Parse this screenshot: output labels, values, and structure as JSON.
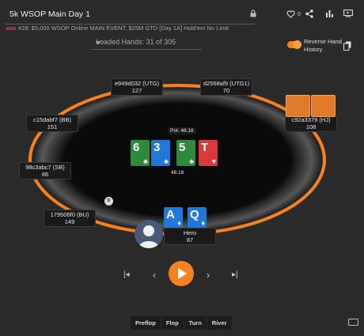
{
  "header": {
    "title": "5k WSOP Main Day 1",
    "hand_history": "#28: $5,000 WSOP Online MAIN EVENT, $25M GTD [Day 1A] Hold'em No Limit",
    "likes": "0"
  },
  "loaded": {
    "label": "Loaded Hands: 31 of 305"
  },
  "reverse": {
    "label": "Reverse Hand History",
    "enabled": true
  },
  "colors": {
    "accent": "#f5821f",
    "felt": "#0d0d0d",
    "spade": "#2e8b3e",
    "club": "#2e8b3e",
    "diamond": "#2178d8",
    "heart": "#d83a3a"
  },
  "players": [
    {
      "id": "utg",
      "name": "e949d032 (UTG)",
      "stack": "127"
    },
    {
      "id": "utg1",
      "name": "d2568af9 (UTG1)",
      "stack": "70"
    },
    {
      "id": "hj",
      "name": "c92a3379 (HJ)",
      "stack": "108"
    },
    {
      "id": "bb",
      "name": "c15dabf7 (BB)",
      "stack": "151"
    },
    {
      "id": "sb",
      "name": "98c3abc7 (SB)",
      "stack": "86"
    },
    {
      "id": "bu",
      "name": "179506f0 (BU)",
      "stack": "149"
    },
    {
      "id": "hero",
      "name": "Hero",
      "stack": "87"
    }
  ],
  "pot": {
    "label": "Pot: 48.18",
    "center_amount": "48.18"
  },
  "board": [
    {
      "rank": "6",
      "suit": "♣"
    },
    {
      "rank": "3",
      "suit": "♣"
    },
    {
      "rank": "5",
      "suit": "♣"
    },
    {
      "rank": "T",
      "suit": "♥"
    }
  ],
  "hero_cards": [
    {
      "rank": "A",
      "suit": "♦"
    },
    {
      "rank": "Q",
      "suit": "♦"
    }
  ],
  "dealer_button": "D",
  "controls": {
    "first": "|◂",
    "prev": "‹",
    "next": "›",
    "last": "▸|"
  },
  "streets": [
    "Preflop",
    "Flop",
    "Turn",
    "River"
  ]
}
